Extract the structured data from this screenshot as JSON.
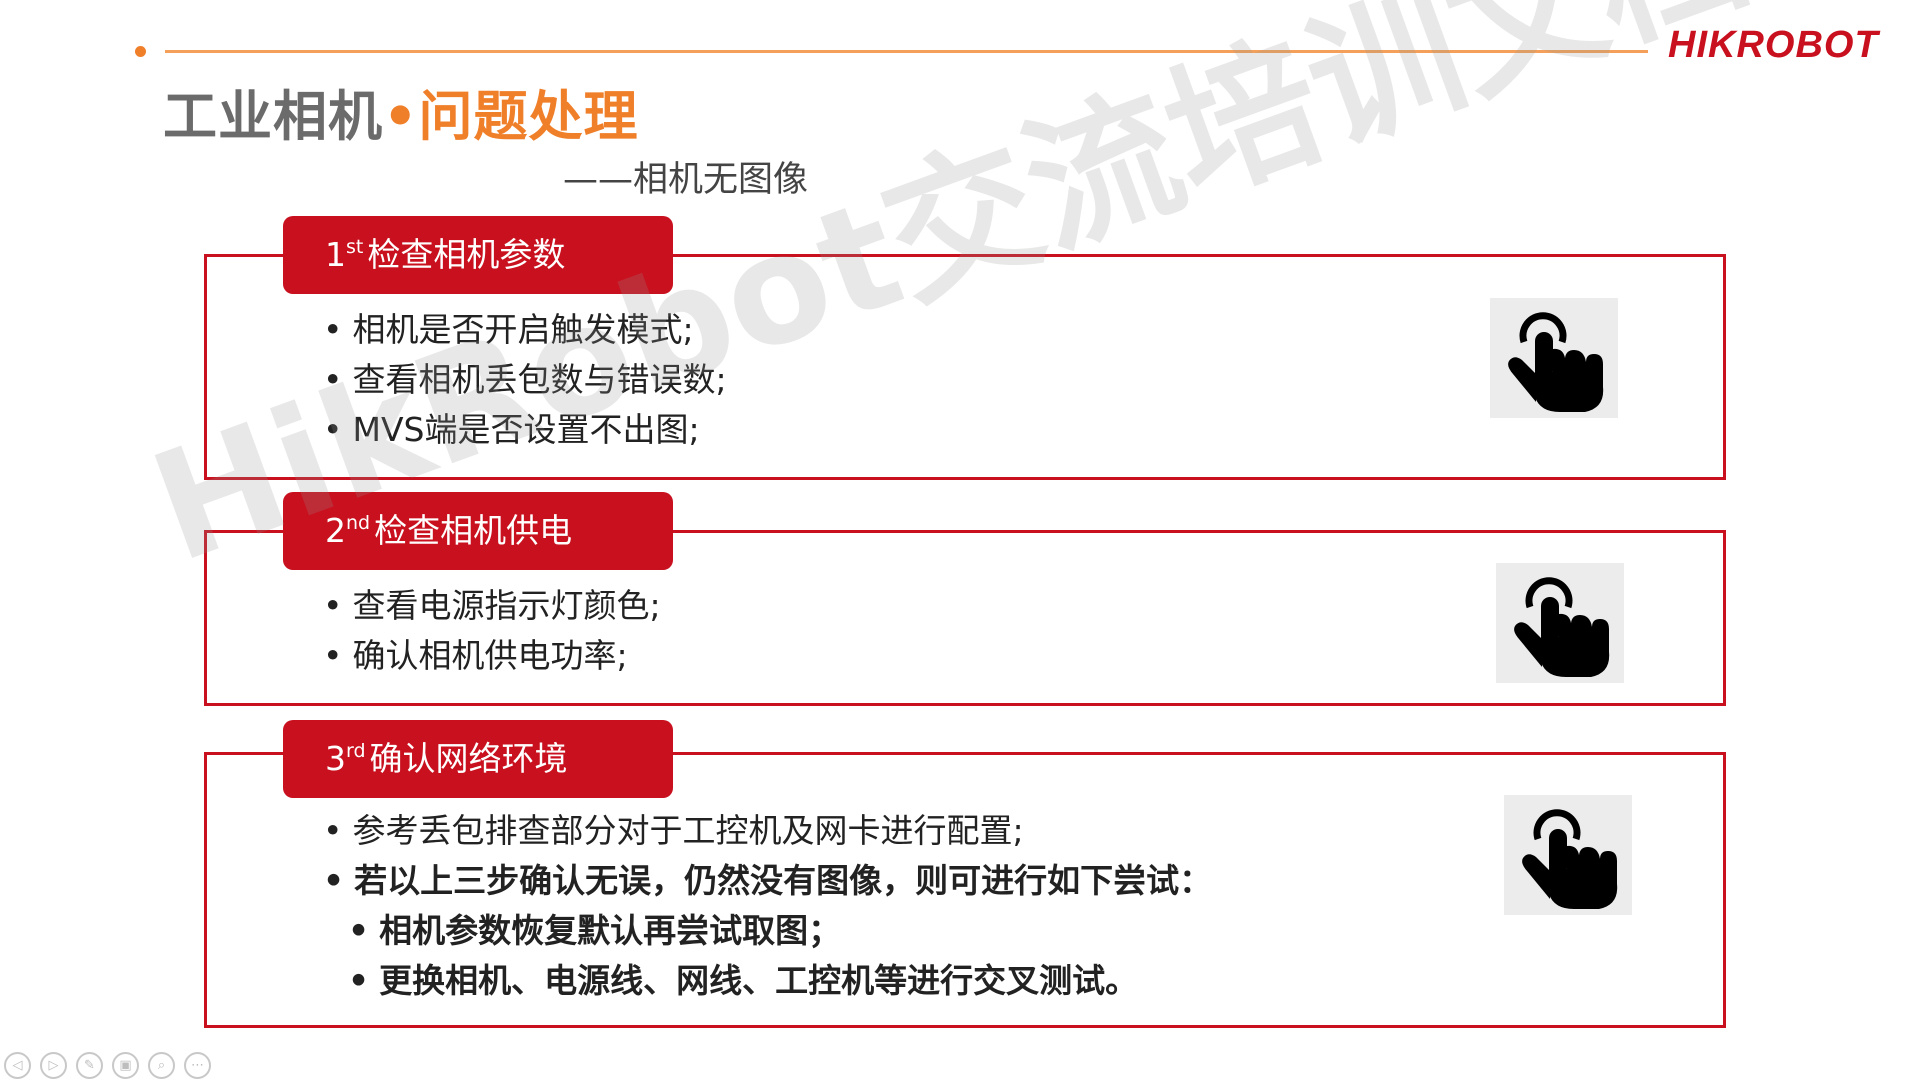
{
  "header": {
    "logo": "HIKROBOT",
    "title_left": "工业相机",
    "title_sep": "•",
    "title_right": "问题处理",
    "subtitle": "——相机无图像"
  },
  "watermark": "HikRobot交流培训文档",
  "sections": [
    {
      "num": "1",
      "sup": "st",
      "label": "检查相机参数",
      "bullets": [
        "相机是否开启触发模式;",
        "查看相机丢包数与错误数;",
        "MVS端是否设置不出图;"
      ]
    },
    {
      "num": "2",
      "sup": "nd",
      "label": "检查相机供电",
      "bullets": [
        "查看电源指示灯颜色;",
        "确认相机供电功率;"
      ]
    },
    {
      "num": "3",
      "sup": "rd",
      "label": "确认网络环境",
      "bullets": [
        "参考丢包排查部分对于工控机及网卡进行配置;",
        "若以上三步确认无误，仍然没有图像，则可进行如下尝试：",
        "相机参数恢复默认再尝试取图；",
        "更换相机、电源线、网线、工控机等进行交叉测试。"
      ]
    }
  ],
  "icons": {
    "hand": "pointing-hand-icon"
  },
  "nav": [
    "◁",
    "▷",
    "✎",
    "▣",
    "⌕",
    "⋯"
  ],
  "colors": {
    "accent_red": "#c8101e",
    "accent_orange": "#f07f2a"
  }
}
